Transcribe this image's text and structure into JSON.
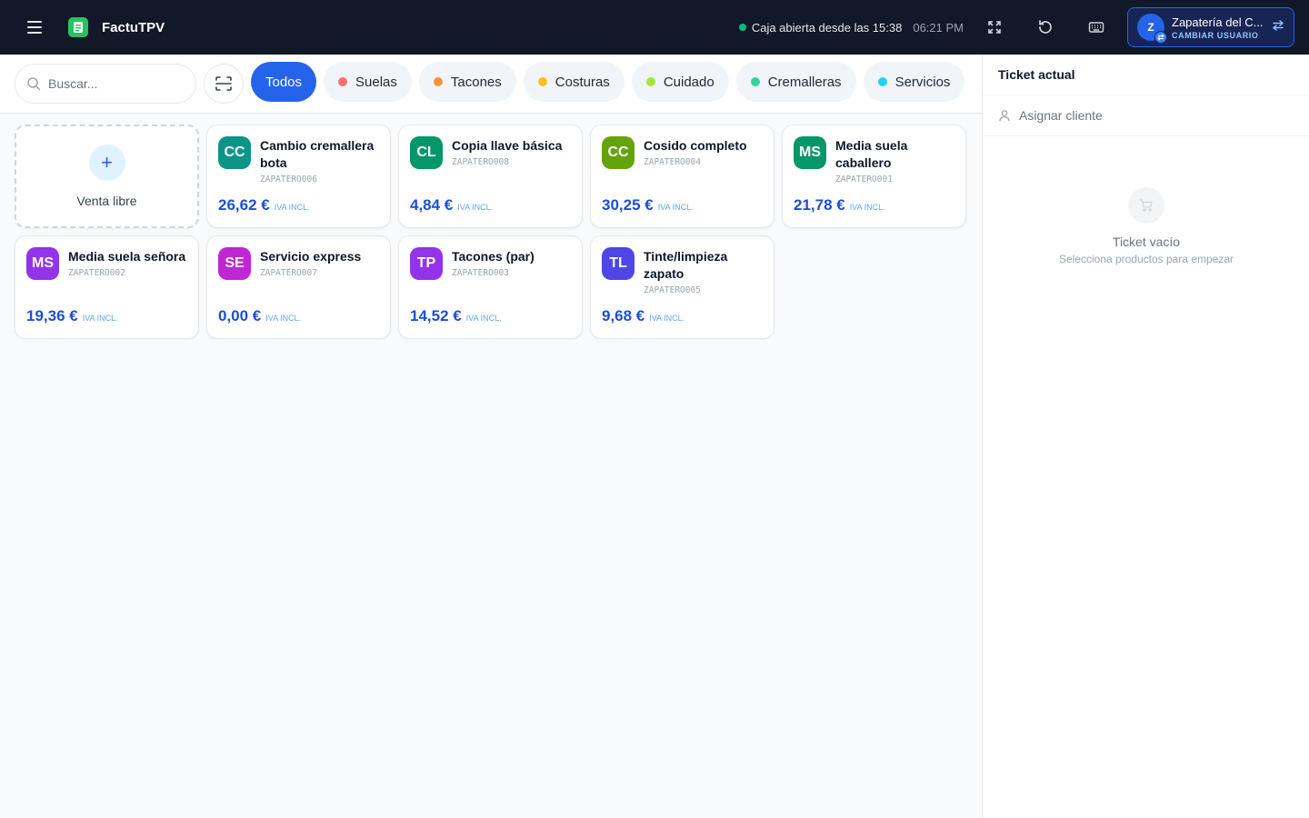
{
  "app": {
    "title": "FactuTPV"
  },
  "header": {
    "status_text": "Caja abierta desde las 15:38",
    "time": "06:21 PM",
    "user": {
      "initial": "Z",
      "name": "Zapatería del C...",
      "action": "CAMBIAR USUARIO"
    }
  },
  "search": {
    "placeholder": "Buscar...",
    "value": ""
  },
  "categories": [
    {
      "label": "Todos",
      "color": "",
      "active": true
    },
    {
      "label": "Suelas",
      "color": "#f87171",
      "active": false
    },
    {
      "label": "Tacones",
      "color": "#fb923c",
      "active": false
    },
    {
      "label": "Costuras",
      "color": "#fbbf24",
      "active": false
    },
    {
      "label": "Cuidado",
      "color": "#a3e635",
      "active": false
    },
    {
      "label": "Cremalleras",
      "color": "#34d399",
      "active": false
    },
    {
      "label": "Servicios",
      "color": "#22d3ee",
      "active": false
    }
  ],
  "free_sale": {
    "label": "Venta libre",
    "icon": "plus-icon"
  },
  "tax_label": "IVA INCL.",
  "products": [
    {
      "initials": "CC",
      "color": "#0d9488",
      "name": "Cambio cremallera bota",
      "sku": "ZAPATERO006",
      "price": "26,62 €"
    },
    {
      "initials": "CL",
      "color": "#059669",
      "name": "Copia llave básica",
      "sku": "ZAPATERO008",
      "price": "4,84 €"
    },
    {
      "initials": "CC",
      "color": "#65a30d",
      "name": "Cosido completo",
      "sku": "ZAPATERO004",
      "price": "30,25 €"
    },
    {
      "initials": "MS",
      "color": "#059669",
      "name": "Media suela caballero",
      "sku": "ZAPATERO001",
      "price": "21,78 €"
    },
    {
      "initials": "MS",
      "color": "#9333ea",
      "name": "Media suela señora",
      "sku": "ZAPATERO002",
      "price": "19,36 €"
    },
    {
      "initials": "SE",
      "color": "#c026d3",
      "name": "Servicio express",
      "sku": "ZAPATERO007",
      "price": "0,00 €"
    },
    {
      "initials": "TP",
      "color": "#9333ea",
      "name": "Tacones (par)",
      "sku": "ZAPATERO003",
      "price": "14,52 €"
    },
    {
      "initials": "TL",
      "color": "#4f46e5",
      "name": "Tinte/limpieza zapato",
      "sku": "ZAPATERO005",
      "price": "9,68 €"
    }
  ],
  "ticket": {
    "title": "Ticket actual",
    "assign_customer": "Asignar cliente",
    "empty_title": "Ticket vacío",
    "empty_subtitle": "Selecciona productos para empezar"
  }
}
